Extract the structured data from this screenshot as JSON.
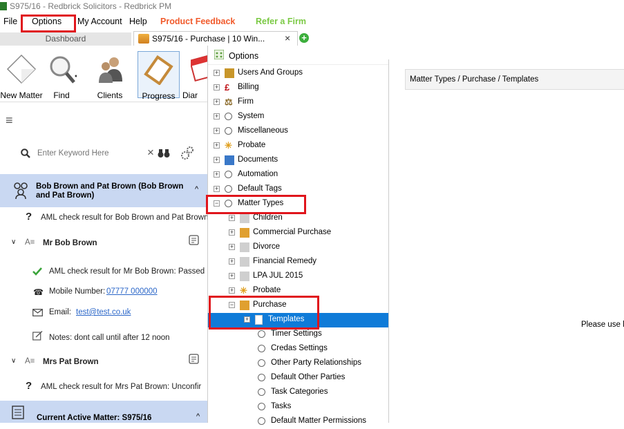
{
  "window": {
    "title": "S975/16 - Redbrick Solicitors - Redbrick PM"
  },
  "menu": {
    "file": "File",
    "options": "Options",
    "my_account": "My Account",
    "help": "Help",
    "product_feedback": "Product Feedback",
    "refer_firm": "Refer a Firm",
    "colors": {
      "product_feedback": "#f15a2b",
      "refer_firm": "#7ac943"
    }
  },
  "tabs": {
    "dashboard": "Dashboard",
    "matter": "S975/16 - Purchase | 10 Win...",
    "close": "×",
    "add": "+"
  },
  "ribbon": {
    "new_matter": "New Matter",
    "find": "Find",
    "clients": "Clients",
    "progress": "Progress",
    "diary": "Diar"
  },
  "search": {
    "placeholder": "Enter Keyword Here"
  },
  "client": {
    "header": "Bob Brown and Pat Brown (Bob Brown and Pat Brown)",
    "aml_joint": "AML check result for Bob Brown and Pat Brown:",
    "person1": {
      "name": "Mr Bob Brown",
      "aml": "AML check result for Mr Bob Brown: Passed",
      "mobile_label": "Mobile Number:",
      "mobile": "07777 000000",
      "email_label": "Email:",
      "email": "test@test.co.uk",
      "notes": "Notes: dont call until after 12 noon"
    },
    "person2": {
      "name": "Mrs Pat Brown",
      "aml": "AML check result for Mrs Pat Brown: Unconfir"
    },
    "current_matter": "Current Active Matter: S975/16"
  },
  "options": {
    "title": "Options",
    "tree": [
      {
        "label": "Users And Groups",
        "icon": "users-icon"
      },
      {
        "label": "Billing",
        "icon": "pound-icon"
      },
      {
        "label": "Firm",
        "icon": "scales-icon"
      },
      {
        "label": "System",
        "icon": "radio-icon"
      },
      {
        "label": "Miscellaneous",
        "icon": "radio-icon"
      },
      {
        "label": "Probate",
        "icon": "sun-icon"
      },
      {
        "label": "Documents",
        "icon": "documents-icon"
      },
      {
        "label": "Automation",
        "icon": "radio-icon"
      },
      {
        "label": "Default Tags",
        "icon": "radio-icon"
      },
      {
        "label": "Matter Types",
        "icon": "radio-icon"
      },
      {
        "label": "Children",
        "icon": "folder-icon"
      },
      {
        "label": "Commercial Purchase",
        "icon": "house-icon"
      },
      {
        "label": "Divorce",
        "icon": "folder-icon"
      },
      {
        "label": "Financial Remedy",
        "icon": "folder-icon"
      },
      {
        "label": "LPA JUL 2015",
        "icon": "folder-icon"
      },
      {
        "label": "Probate",
        "icon": "sun-icon"
      },
      {
        "label": "Purchase",
        "icon": "house-icon"
      },
      {
        "label": "Templates",
        "icon": "document-icon"
      },
      {
        "label": "Timer Settings",
        "icon": "radio-icon"
      },
      {
        "label": "Credas Settings",
        "icon": "radio-icon"
      },
      {
        "label": "Other Party Relationships",
        "icon": "radio-icon"
      },
      {
        "label": "Default Other Parties",
        "icon": "radio-icon"
      },
      {
        "label": "Task Categories",
        "icon": "radio-icon"
      },
      {
        "label": "Tasks",
        "icon": "radio-icon"
      },
      {
        "label": "Default Matter Permissions",
        "icon": "radio-icon"
      }
    ]
  },
  "right_pane": {
    "breadcrumb": "Matter Types / Purchase / Templates",
    "hint": "Please use le"
  }
}
